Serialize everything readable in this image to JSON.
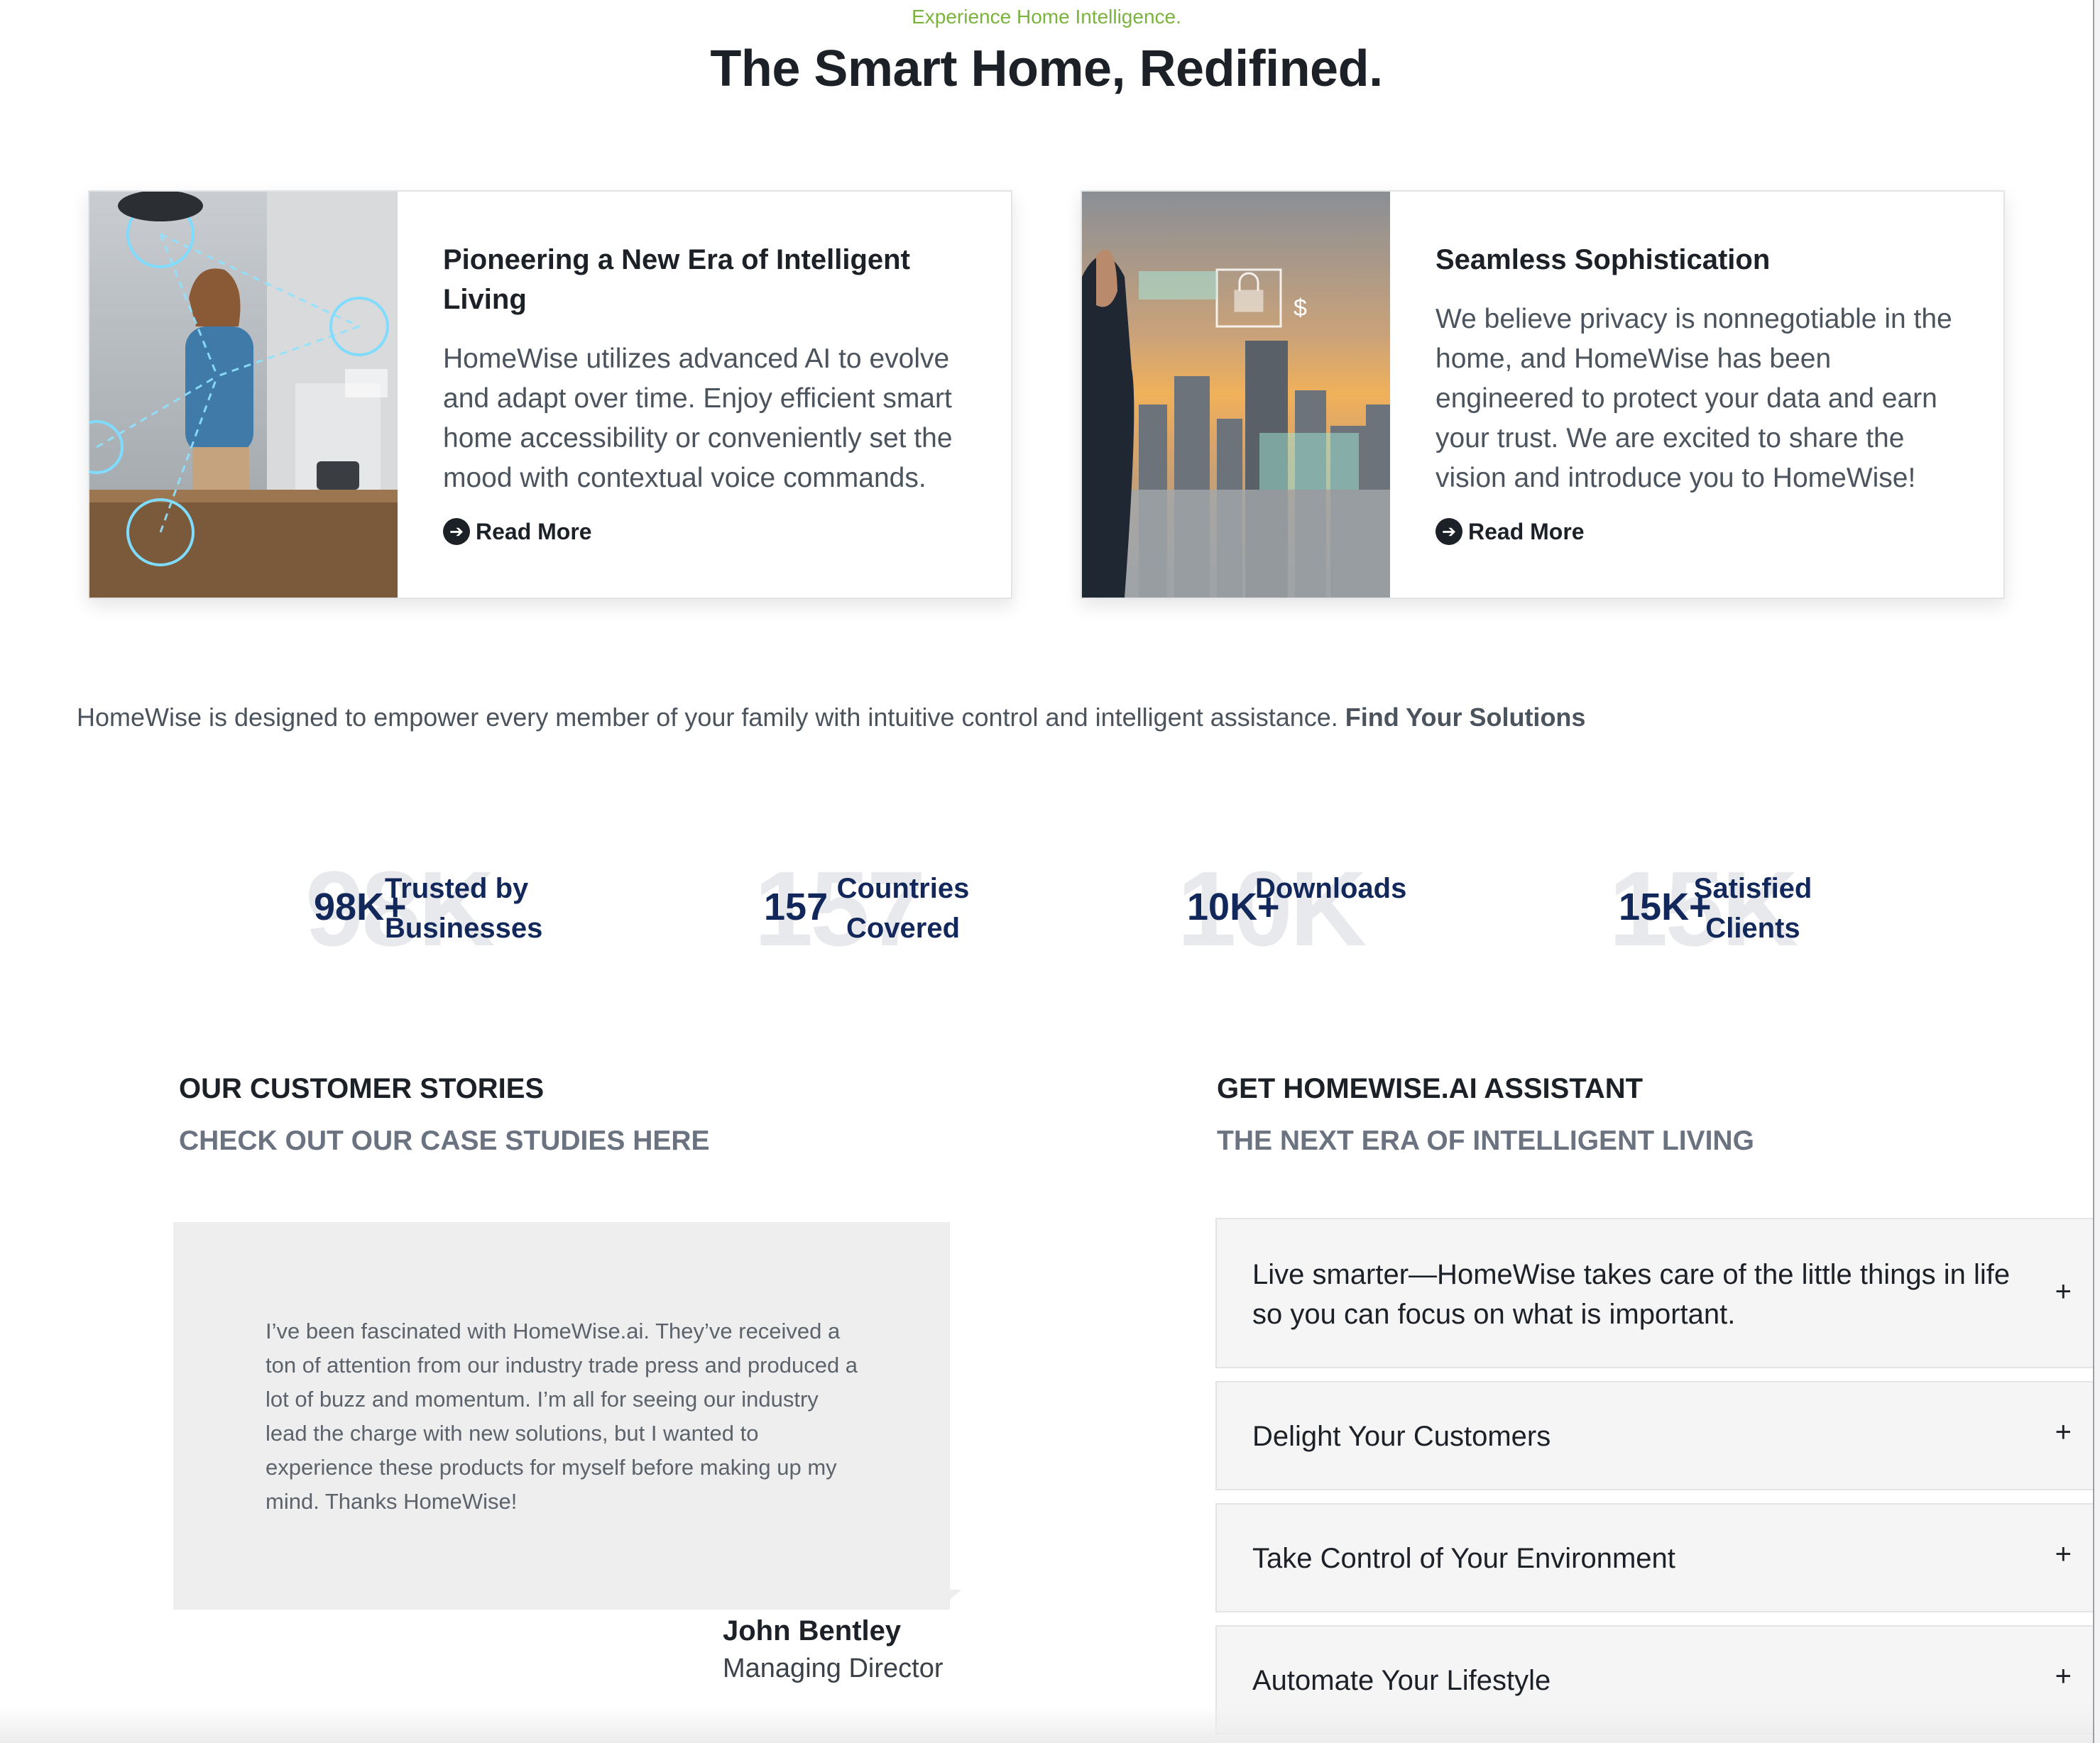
{
  "hero": {
    "eyebrow": "Experience Home Intelligence.",
    "headline": "The Smart Home, Redifined."
  },
  "cards": [
    {
      "title": "Pioneering a New Era of Intelligent Living",
      "text": "HomeWise utilizes advanced AI to evolve and adapt over time. Enjoy efficient smart home accessibility or conveniently set the mood with contextual voice commands.",
      "cta": "Read More",
      "image_alt": "woman-in-smart-kitchen"
    },
    {
      "title": "Seamless Sophistication",
      "text": "We believe privacy is nonnegotiable in the home, and HomeWise has been engineered to protect your data and earn your trust. We are excited to share the vision and introduce you to HomeWise!",
      "cta": "Read More",
      "image_alt": "businessman-viewing-city"
    }
  ],
  "intro": {
    "text": "HomeWise is designed to empower every member of your family with intuitive control and intelligent assistance.",
    "link": "Find Your Solutions"
  },
  "stats": [
    {
      "bg": "98K",
      "value": "98K+",
      "line1": "Trusted by",
      "line2": "Businesses"
    },
    {
      "bg": "157",
      "value": "157",
      "line1": "Countries",
      "line2": "Covered"
    },
    {
      "bg": "10K",
      "value": "10K+",
      "line1": "Downloads",
      "line2": ""
    },
    {
      "bg": "15K",
      "value": "15K+",
      "line1": "Satisfied",
      "line2": "Clients"
    }
  ],
  "stories": {
    "title": "OUR CUSTOMER STORIES",
    "subtitle": "CHECK OUT OUR CASE STUDIES HERE",
    "quote": "I’ve been fascinated with HomeWise.ai. They’ve received a ton of attention from our industry trade press and produced a lot of buzz and momentum. I’m all for seeing our industry lead the charge with new solutions, but I wanted to experience these products for myself before making up my mind. Thanks HomeWise!",
    "author": "John Bentley",
    "role": "Managing Director"
  },
  "assistant": {
    "title": "GET HOMEWISE.AI ASSISTANT",
    "subtitle": "THE NEXT ERA OF INTELLIGENT LIVING",
    "items": [
      {
        "label": "Live smarter—HomeWise takes care of the little things in life so you can focus on what is important.",
        "icon": "+"
      },
      {
        "label": "Delight Your Customers",
        "icon": "+"
      },
      {
        "label": "Take Control of Your Environment",
        "icon": "+"
      },
      {
        "label": "Automate Your Lifestyle",
        "icon": "+"
      }
    ]
  },
  "colors": {
    "accent_green": "#7bb33d",
    "stat_navy": "#13285a",
    "heading": "#1c2027",
    "body_text": "#4b535d"
  }
}
